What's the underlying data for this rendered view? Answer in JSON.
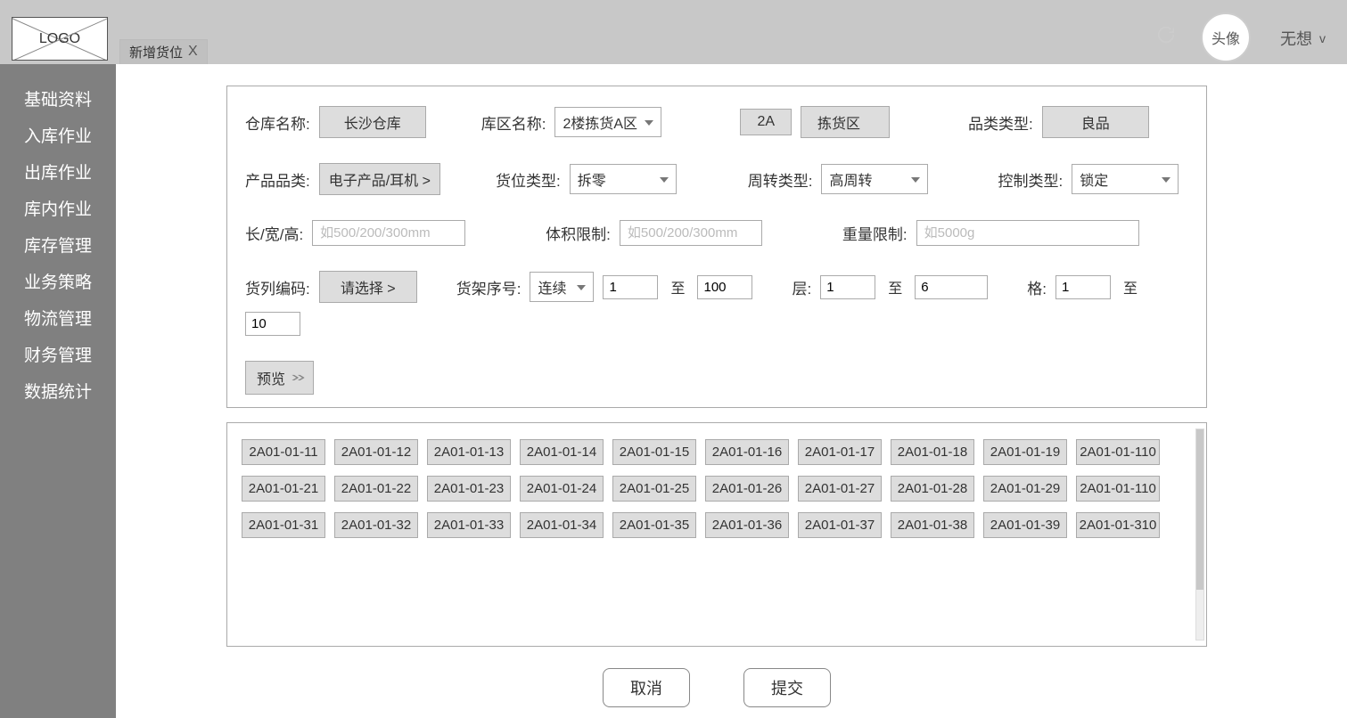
{
  "header": {
    "logo_text": "LOGO",
    "tab_label": "新增货位",
    "avatar_text": "头像",
    "username": "无想"
  },
  "sidebar": {
    "items": [
      "基础资料",
      "入库作业",
      "出库作业",
      "库内作业",
      "库存管理",
      "业务策略",
      "物流管理",
      "财务管理",
      "数据统计"
    ]
  },
  "form": {
    "warehouse_label": "仓库名称:",
    "warehouse_value": "长沙仓库",
    "area_label": "库区名称:",
    "area_value": "2楼拣货A区",
    "area_code": "2A",
    "area_type": "拣货区",
    "category_type_label": "品类类型:",
    "category_type_value": "良品",
    "product_cat_label": "产品品类:",
    "product_cat_value": "电子产品/耳机 >",
    "loc_type_label": "货位类型:",
    "loc_type_value": "拆零",
    "turnover_label": "周转类型:",
    "turnover_value": "高周转",
    "control_label": "控制类型:",
    "control_value": "锁定",
    "dim_label": "长/宽/高:",
    "dim_placeholder": "如500/200/300mm",
    "volume_label": "体积限制:",
    "volume_placeholder": "如500/200/300mm",
    "weight_label": "重量限制:",
    "weight_placeholder": "如5000g",
    "column_code_label": "货列编码:",
    "column_code_value": "请选择 >",
    "shelf_no_label": "货架序号:",
    "shelf_mode": "连续",
    "shelf_from": "1",
    "shelf_to": "100",
    "layer_label": "层:",
    "layer_from": "1",
    "layer_to": "6",
    "cell_label": "格:",
    "cell_from": "1",
    "cell_to": "10",
    "to_text": "至",
    "preview_label": "预览"
  },
  "preview_grid": {
    "cells": [
      "2A01-01-11",
      "2A01-01-12",
      "2A01-01-13",
      "2A01-01-14",
      "2A01-01-15",
      "2A01-01-16",
      "2A01-01-17",
      "2A01-01-18",
      "2A01-01-19",
      "2A01-01-110",
      "2A01-01-21",
      "2A01-01-22",
      "2A01-01-23",
      "2A01-01-24",
      "2A01-01-25",
      "2A01-01-26",
      "2A01-01-27",
      "2A01-01-28",
      "2A01-01-29",
      "2A01-01-110",
      "2A01-01-31",
      "2A01-01-32",
      "2A01-01-33",
      "2A01-01-34",
      "2A01-01-35",
      "2A01-01-36",
      "2A01-01-37",
      "2A01-01-38",
      "2A01-01-39",
      "2A01-01-310"
    ]
  },
  "actions": {
    "cancel": "取消",
    "submit": "提交"
  }
}
